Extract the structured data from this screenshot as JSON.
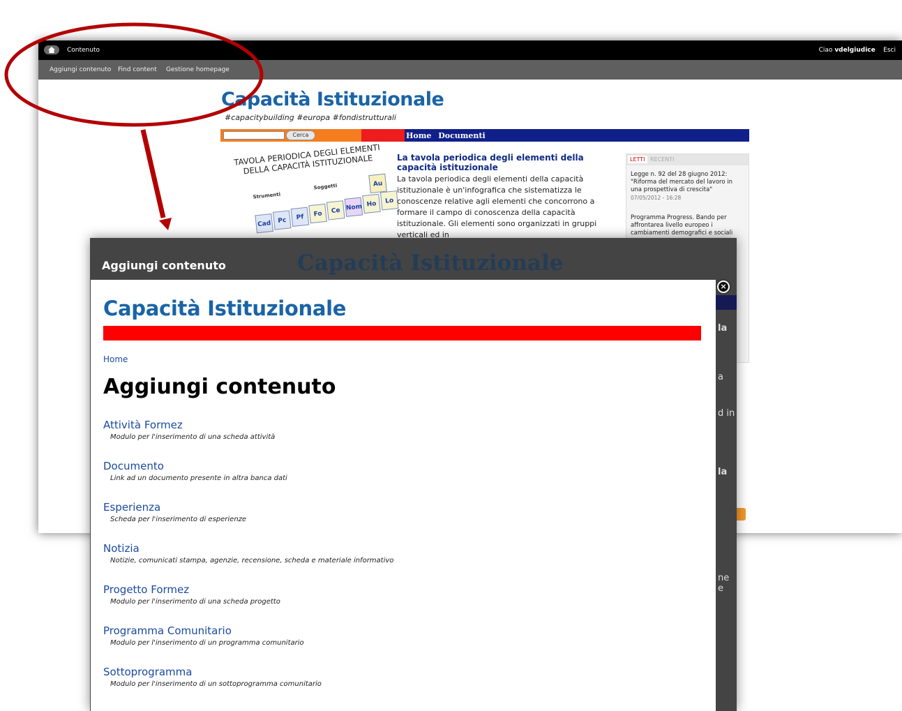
{
  "toolbar": {
    "contenuto_label": "Contenuto",
    "greeting": "Ciao",
    "username": "vdelgiudice",
    "logout_label": "Esci",
    "sub_links": [
      "Aggiungi contenuto",
      "Find content",
      "Gestione homepage"
    ]
  },
  "site": {
    "title": "Capacità Istituzionale",
    "tags": "#capacitybuilding  #europa  #fondistrutturali",
    "search_button": "Cerca",
    "nav": [
      "Home",
      "Documenti"
    ],
    "infographic_title": "TAVOLA PERIODICA DEGLI ELEMENTI DELLA CAPACITÀ ISTITUZIONALE",
    "infographic_groups": [
      "Strumenti",
      "Soggetti"
    ],
    "infographic_cells": [
      "Au",
      "Nom",
      "Ho",
      "Ce",
      "Fo",
      "Pf",
      "Pc",
      "Cad",
      "Lo"
    ],
    "article_title": "La tavola periodica degli elementi della capacità istituzionale",
    "article_body": "La tavola periodica degli elementi della capacità istituzionale è un'infografica che sistematizza le conoscenze relative agli elementi che concorrono a formare il campo di conoscenza della capacità istituzionale. Gli elementi sono organizzati in gruppi verticali ed in",
    "sidebar": {
      "tab_active": "LETTI",
      "tab_other": "RECENTI",
      "items": [
        {
          "text": "Legge n. 92 del 28 giugno 2012: \"Riforma del mercato del lavoro in una prospettiva di crescita\"",
          "date": "07/05/2012 - 16:28"
        },
        {
          "text": "Programma Progress. Bando per affrontarea livello europeo i cambiamenti demografici e sociali",
          "date": ""
        }
      ]
    }
  },
  "modal": {
    "header_title": "Aggiungi contenuto",
    "ghost_title": "Capacità Istituzionale",
    "close_symbol": "×",
    "site_title": "Capacità Istituzionale",
    "breadcrumb": "Home",
    "page_title": "Aggiungi contenuto",
    "ghost_fragments": [
      "la",
      "a",
      "d in",
      "la",
      "ne e"
    ],
    "content_types": [
      {
        "name": "Attività Formez",
        "desc": "Modulo per l'inserimento di una scheda attività"
      },
      {
        "name": "Documento",
        "desc": "Link ad un documento presente in altra banca dati"
      },
      {
        "name": "Esperienza",
        "desc": "Scheda per l'inserimento di esperienze"
      },
      {
        "name": "Notizia",
        "desc": "Notizie, comunicati stampa, agenzie, recensione, scheda e materiale informativo"
      },
      {
        "name": "Progetto Formez",
        "desc": "Modulo per l'inserimento di una scheda progetto"
      },
      {
        "name": "Programma Comunitario",
        "desc": "Modulo per l'inserimento di un programma comunitario"
      },
      {
        "name": "Sottoprogramma",
        "desc": "Modulo per l'inserimento di un sottoprogramma comunitario"
      }
    ]
  },
  "colors": {
    "site_blue": "#1a64a6",
    "link_blue": "#1a4aa0",
    "annotation_red": "#b30000",
    "nav_blue": "#10208a",
    "bar_red": "#ff0000"
  }
}
